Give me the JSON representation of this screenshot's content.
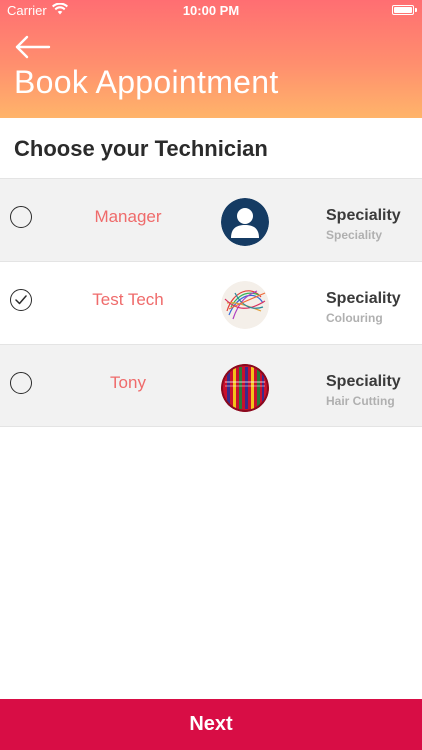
{
  "status_bar": {
    "carrier": "Carrier",
    "time": "10:00 PM",
    "wifi_icon": "wifi-icon",
    "battery_icon": "battery-icon"
  },
  "header": {
    "back_icon": "arrow-left-icon",
    "title": "Book Appointment",
    "gradient_colors": [
      "#ff6e72",
      "#ffb46a"
    ]
  },
  "section": {
    "title": "Choose your Technician"
  },
  "technicians": [
    {
      "name": "Manager",
      "selected": false,
      "avatar": "default-user-avatar",
      "speciality_label": "Speciality",
      "speciality_value": "Speciality"
    },
    {
      "name": "Test Tech",
      "selected": true,
      "avatar": "scribble-photo-avatar",
      "speciality_label": "Speciality",
      "speciality_value": "Colouring"
    },
    {
      "name": "Tony",
      "selected": false,
      "avatar": "colorful-pattern-avatar",
      "speciality_label": "Speciality",
      "speciality_value": "Hair Cutting"
    }
  ],
  "footer": {
    "next_label": "Next",
    "accent_color": "#d80d45"
  },
  "colors": {
    "tech_name": "#ef6b6b",
    "row_alt_bg": "#f2f2f2"
  }
}
